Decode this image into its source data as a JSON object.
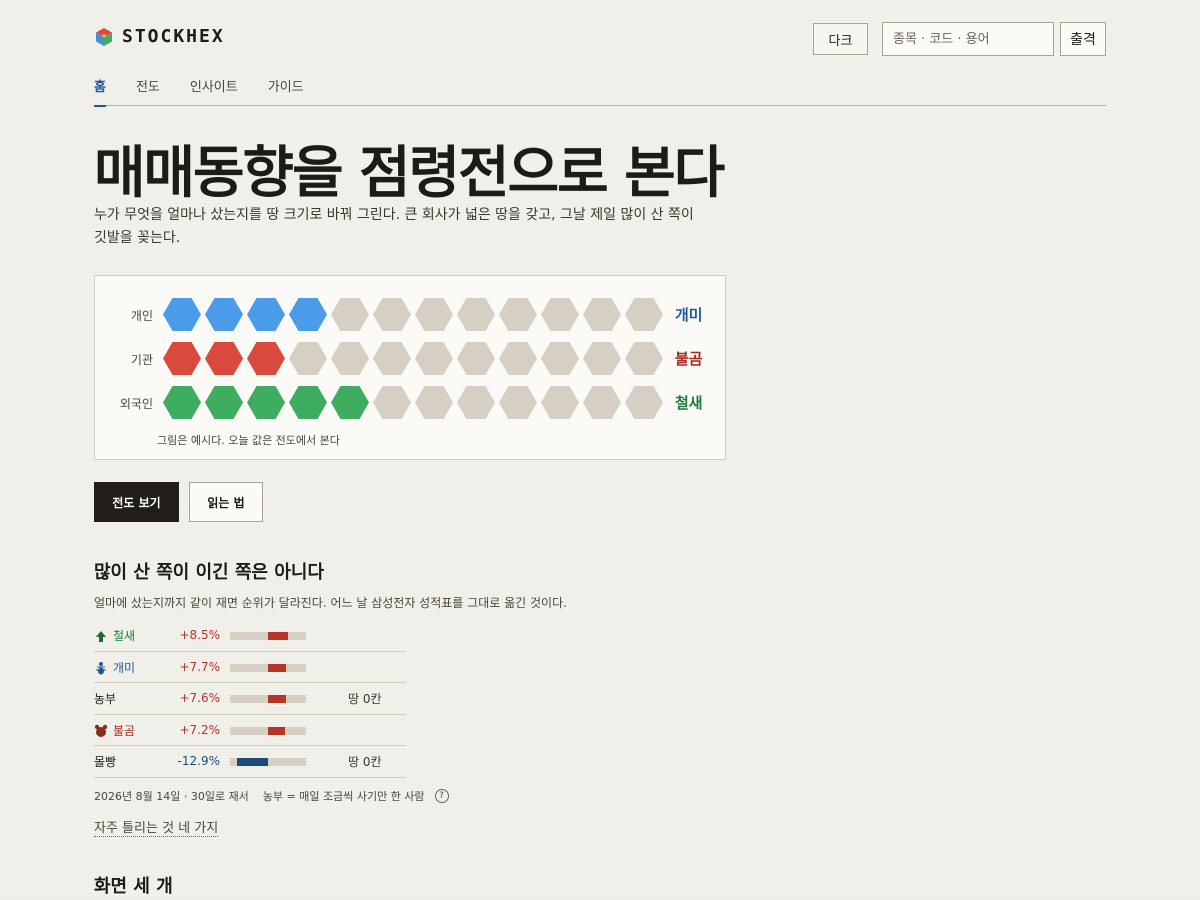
{
  "app": {
    "logo_text": "STOCKHEX",
    "logo_colors": [
      "#e0473d",
      "#3f8fdc",
      "#43ad5c",
      "#f2b431"
    ]
  },
  "header": {
    "theme_button": "다크",
    "search_placeholder": "종목 · 코드 · 용어",
    "go_button": "출격"
  },
  "nav": {
    "items": [
      {
        "label": "홈",
        "active": true
      },
      {
        "label": "전도",
        "active": false
      },
      {
        "label": "인사이트",
        "active": false
      },
      {
        "label": "가이드",
        "active": false
      }
    ]
  },
  "hero": {
    "title": "매매동향을 점령전으로 본다",
    "lead": "누가 무엇을 얼마나 샀는지를 땅 크기로 바꿔 그린다. 큰 회사가 넓은 땅을 갖고, 그날 제일 많이 산 쪽이 깃발을 꽂는다."
  },
  "territory": {
    "total_cells": 12,
    "empty_color": "#d6cfc3",
    "rows": [
      {
        "label": "개인",
        "filled": 4,
        "color": "#4a9be8",
        "tag": "개미",
        "tag_color": "#1f5a96"
      },
      {
        "label": "기관",
        "filled": 3,
        "color": "#d9493d",
        "tag": "불곰",
        "tag_color": "#a8281f"
      },
      {
        "label": "외국인",
        "filled": 5,
        "color": "#3ead60",
        "tag": "철새",
        "tag_color": "#1e7a3a"
      }
    ],
    "note": "그림은 예시다. 오늘 값은 전도에서 본다"
  },
  "actions": {
    "primary": "전도 보기",
    "secondary": "읽는 법"
  },
  "ranking": {
    "title": "많이 산 쪽이 이긴 쪽은 아니다",
    "description": "얼마에 샀는지까지 같이 재면 순위가 달라진다. 어느 날 삼성전자 성적표를 그대로 옮긴 것이다.",
    "max_abs_pct": 20,
    "rows": [
      {
        "icon": "bird-icon",
        "name": "철새",
        "name_color": "#1e7a3a",
        "pct": "+8.5%",
        "value": 8.5,
        "extra": ""
      },
      {
        "icon": "ant-icon",
        "name": "개미",
        "name_color": "#1f5a96",
        "pct": "+7.7%",
        "value": 7.7,
        "extra": ""
      },
      {
        "icon": "",
        "name": "농부",
        "name_color": "#1d1b17",
        "pct": "+7.6%",
        "value": 7.6,
        "extra": "땅 0칸"
      },
      {
        "icon": "bear-icon",
        "name": "불곰",
        "name_color": "#a8281f",
        "pct": "+7.2%",
        "value": 7.2,
        "extra": ""
      },
      {
        "icon": "",
        "name": "몰빵",
        "name_color": "#1d1b17",
        "pct": "-12.9%",
        "value": -12.9,
        "extra": "땅 0칸"
      }
    ],
    "pos_color": "#b8342b",
    "neg_color": "#1d4a7a",
    "pos_text_color": "#b8342b",
    "neg_text_color": "#1d4a7a",
    "footnote": "2026년 8월 14일 · 30일로 재서    농부 = 매일 조금씩 사기만 한 사람",
    "help": "?",
    "faq_link": "자주 틀리는 것 네 가지"
  },
  "screens": {
    "title": "화면 세 개"
  }
}
